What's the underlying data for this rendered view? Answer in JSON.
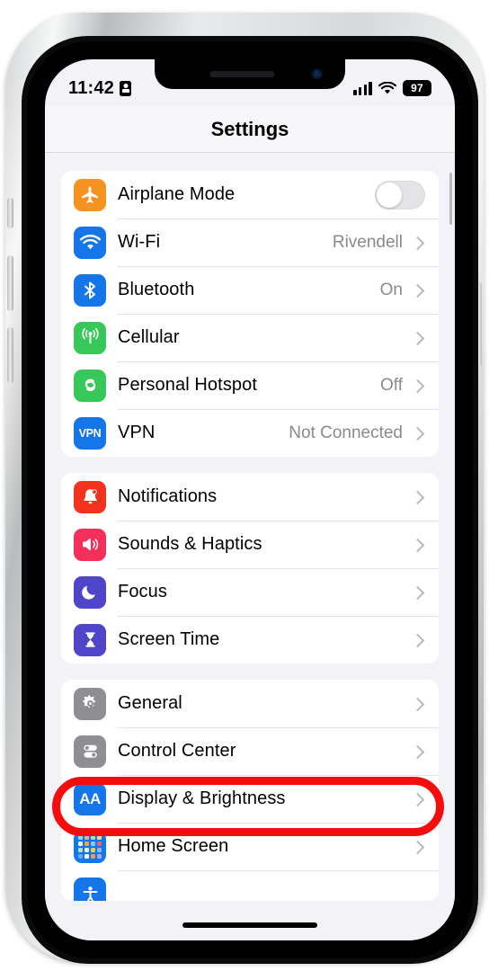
{
  "status_bar": {
    "time": "11:42",
    "lock_icon": "portrait-lock-icon",
    "signal_icon": "cellular-signal-icon",
    "wifi_icon": "wifi-icon",
    "battery_percent": "97"
  },
  "nav": {
    "title": "Settings"
  },
  "annotation": {
    "type": "red-oval-highlight",
    "color": "#f50d0d",
    "target": "General"
  },
  "groups": [
    {
      "id": "connectivity",
      "rows": [
        {
          "label": "Airplane Mode",
          "icon": "airplane-icon",
          "icon_color": "#f59321",
          "control": "toggle",
          "toggle_on": false
        },
        {
          "label": "Wi-Fi",
          "icon": "wifi-icon",
          "icon_color": "#1476e8",
          "value": "Rivendell",
          "control": "chevron"
        },
        {
          "label": "Bluetooth",
          "icon": "bluetooth-icon",
          "icon_color": "#1476e8",
          "value": "On",
          "control": "chevron"
        },
        {
          "label": "Cellular",
          "icon": "cellular-antenna-icon",
          "icon_color": "#38c759",
          "value": "",
          "control": "chevron"
        },
        {
          "label": "Personal Hotspot",
          "icon": "hotspot-link-icon",
          "icon_color": "#38c759",
          "value": "Off",
          "control": "chevron"
        },
        {
          "label": "VPN",
          "icon": "vpn-icon",
          "icon_color": "#1476e8",
          "value": "Not Connected",
          "control": "chevron"
        }
      ]
    },
    {
      "id": "alerts",
      "rows": [
        {
          "label": "Notifications",
          "icon": "bell-icon",
          "icon_color": "#f3331f",
          "value": "",
          "control": "chevron"
        },
        {
          "label": "Sounds & Haptics",
          "icon": "speaker-icon",
          "icon_color": "#f4305a",
          "value": "",
          "control": "chevron"
        },
        {
          "label": "Focus",
          "icon": "moon-icon",
          "icon_color": "#4f45c8",
          "value": "",
          "control": "chevron"
        },
        {
          "label": "Screen Time",
          "icon": "hourglass-icon",
          "icon_color": "#4f45c8",
          "value": "",
          "control": "chevron"
        }
      ]
    },
    {
      "id": "system",
      "rows": [
        {
          "label": "General",
          "icon": "gear-icon",
          "icon_color": "#8e8e93",
          "value": "",
          "control": "chevron",
          "highlighted": true
        },
        {
          "label": "Control Center",
          "icon": "control-center-icon",
          "icon_color": "#8e8e93",
          "value": "",
          "control": "chevron"
        },
        {
          "label": "Display & Brightness",
          "icon": "display-aa-icon",
          "icon_color": "#1476e8",
          "value": "",
          "control": "chevron"
        },
        {
          "label": "Home Screen",
          "icon": "home-screen-grid-icon",
          "icon_color": "#1476e8",
          "value": "",
          "control": "chevron"
        },
        {
          "label": "",
          "icon": "accessibility-icon",
          "icon_color": "#1476e8",
          "value": "",
          "control": "none",
          "cut_off": true
        }
      ]
    }
  ],
  "colors": {
    "page_background": "#f2f2f7",
    "card_background": "#ffffff",
    "value_text": "#8a8a8e",
    "annotation_red": "#f50d0d"
  }
}
